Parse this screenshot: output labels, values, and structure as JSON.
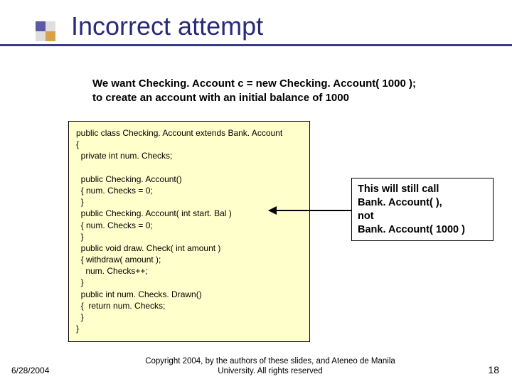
{
  "title": "Incorrect attempt",
  "intro_line1": "We want Checking. Account c = new Checking. Account( 1000 );",
  "intro_line2": "to create an account with an initial balance of 1000",
  "code": "public class Checking. Account extends Bank. Account\n{\n  private int num. Checks;\n\n  public Checking. Account()\n  { num. Checks = 0;\n  }\n  public Checking. Account( int start. Bal )\n  { num. Checks = 0;\n  }\n  public void draw. Check( int amount )\n  { withdraw( amount );\n    num. Checks++;\n  }\n  public int num. Checks. Drawn()\n  {  return num. Checks;\n  }\n}",
  "callout_line1": "This will still call",
  "callout_line2": "Bank. Account( ),",
  "callout_line3": "not",
  "callout_line4": "Bank. Account( 1000 )",
  "footer": {
    "date": "6/28/2004",
    "copyright": "Copyright 2004, by the authors of these slides, and Ateneo de Manila University. All rights reserved",
    "page": "18"
  },
  "colors": {
    "title": "#2a2a7a",
    "codebg": "#ffffcc"
  }
}
